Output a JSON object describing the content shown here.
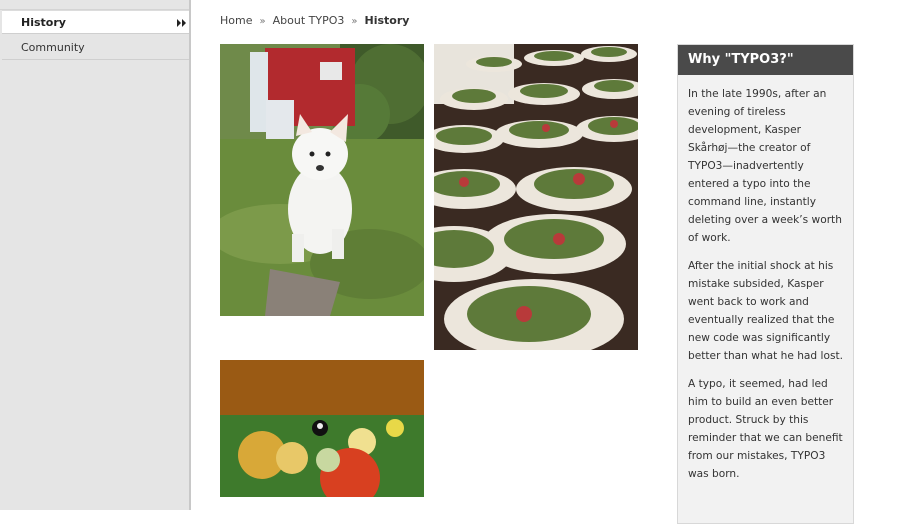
{
  "sidebar": {
    "items": [
      {
        "label": "History",
        "active": true,
        "icon": "double-chevron-right-icon"
      },
      {
        "label": "Community",
        "active": false
      }
    ]
  },
  "breadcrumb": {
    "items": [
      "Home",
      "About TYPO3",
      "History"
    ],
    "separator": "»"
  },
  "images": [
    {
      "name": "puppy-photo"
    },
    {
      "name": "salad-plates-photo"
    },
    {
      "name": "billiard-balls-photo"
    }
  ],
  "why_box": {
    "title": "Why \"TYPO3?\"",
    "paragraphs": [
      "In the late 1990s, after an evening of tireless development, Kasper Skårhøj—the creator of TYPO3—inadvertently entered a typo into the command line, instantly deleting over a week’s worth of work.",
      "After the initial shock at his mistake subsided, Kasper went back to work and eventually realized that the new code was significantly better than what he had lost.",
      "A typo, it seemed, had led him to build an even better product. Struck by this reminder that we can benefit from our mistakes, TYPO3 was born."
    ]
  },
  "colors": {
    "sidebar_bg": "#e5e5e5",
    "box_header_bg": "#4a4a4a",
    "box_bg": "#f2f2f2"
  }
}
